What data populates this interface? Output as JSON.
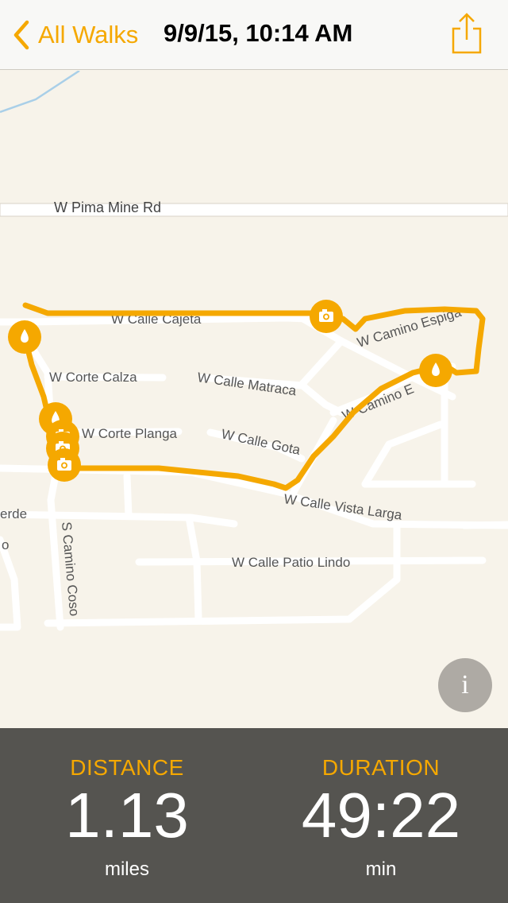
{
  "navbar": {
    "back_label": "All Walks",
    "title": "9/9/15, 10:14 AM"
  },
  "map": {
    "streets": [
      "W Pima Mine Rd",
      "W Calle Cajeta",
      "W Camino Espiga",
      "W Corte Calza",
      "W Calle Matraca",
      "W Camino E",
      "W Corte Planga",
      "W Calle Gota",
      "W Calle Vista Larga",
      "erde",
      "o",
      "S Camino Coso",
      "W Calle Patio Lindo"
    ],
    "route_color": "#f5a800",
    "markers": [
      "drop-icon",
      "camera-icon",
      "drop-icon",
      "drop-icon",
      "camera-icon",
      "camera-icon",
      "camera-icon"
    ]
  },
  "stats": {
    "distance": {
      "label": "DISTANCE",
      "value": "1.13",
      "unit": "miles"
    },
    "duration": {
      "label": "DURATION",
      "value": "49:22",
      "unit": "min"
    }
  },
  "colors": {
    "accent": "#f5a800",
    "panel": "#555450",
    "map_bg": "#f7f3ea"
  }
}
